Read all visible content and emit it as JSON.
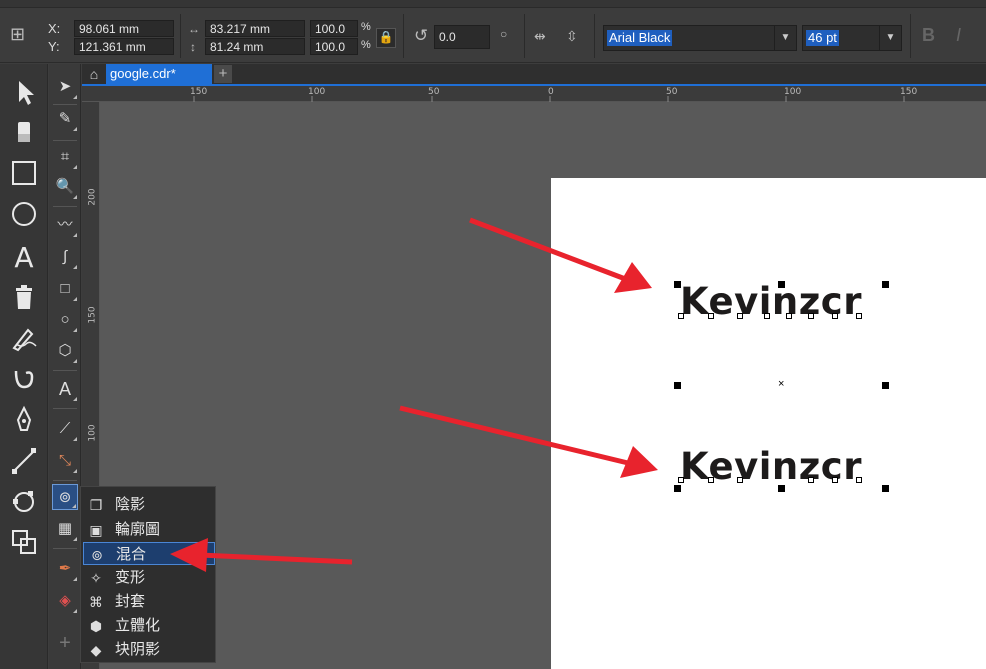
{
  "properties": {
    "x_label": "X:",
    "y_label": "Y:",
    "x_value": "98.061 mm",
    "y_value": "121.361 mm",
    "width_value": "83.217 mm",
    "height_value": "81.24 mm",
    "scale_x": "100.0",
    "scale_y": "100.0",
    "percent": "%",
    "rotation": "0.0",
    "font_name": "Arial Black",
    "font_size": "46 pt"
  },
  "tabs": {
    "document": "google.cdr*",
    "add": "+"
  },
  "ruler": {
    "h_ticks": [
      "150",
      "100",
      "50",
      "0",
      "50",
      "100",
      "150"
    ],
    "v_ticks": [
      "200",
      "150",
      "100"
    ]
  },
  "canvas": {
    "text_top": "Kevinzcr",
    "text_bottom": "Kevinzcr",
    "center_mark": "×"
  },
  "flyout": {
    "items": [
      {
        "label": "陰影",
        "icon": "drop-shadow-icon"
      },
      {
        "label": "輪廓圖",
        "icon": "contour-icon"
      },
      {
        "label": "混合",
        "icon": "blend-icon"
      },
      {
        "label": "变形",
        "icon": "distort-icon"
      },
      {
        "label": "封套",
        "icon": "envelope-icon"
      },
      {
        "label": "立體化",
        "icon": "extrude-icon"
      },
      {
        "label": "块阴影",
        "icon": "block-shadow-icon"
      }
    ],
    "selected_index": 2
  },
  "colors": {
    "accent": "#1f6fd6",
    "annotation_arrow": "#e8232d"
  }
}
